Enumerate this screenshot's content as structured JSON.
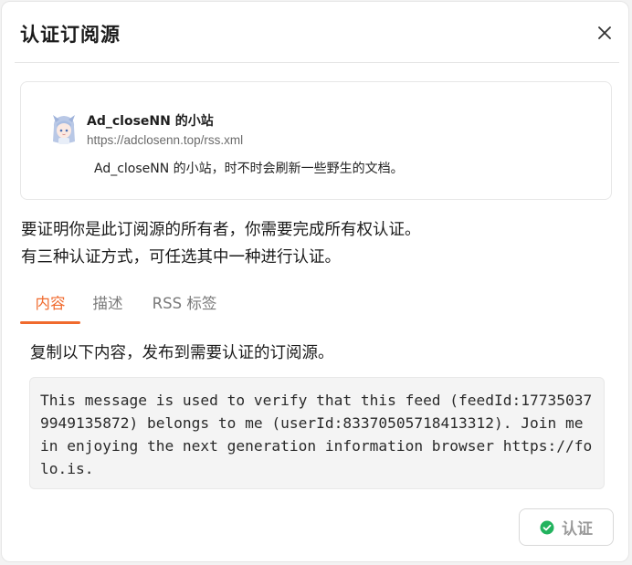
{
  "dialog": {
    "title": "认证订阅源",
    "close_icon": "close-icon"
  },
  "feed": {
    "name": "Ad_closeNN 的小站",
    "url": "https://adclosenn.top/rss.xml",
    "description": "Ad_closeNN 的小站，时不时会刷新一些野生的文档。",
    "avatar_icon": "anime-avatar-icon"
  },
  "intro": {
    "line1": "要证明你是此订阅源的所有者，你需要完成所有权认证。",
    "line2": "有三种认证方式，可任选其中一种进行认证。"
  },
  "tabs": [
    {
      "label": "内容",
      "active": true
    },
    {
      "label": "描述",
      "active": false
    },
    {
      "label": "RSS 标签",
      "active": false
    }
  ],
  "content_tab": {
    "instruction": "复制以下内容，发布到需要认证的订阅源。",
    "message": "This message is used to verify that this feed (feedId:177350379949135872) belongs to me (userId:83370505718413312). Join me in enjoying the next generation information browser https://folo.is."
  },
  "verify_button": {
    "label": "认证",
    "icon": "check-circle-icon",
    "icon_color": "#22b35e"
  },
  "colors": {
    "accent": "#f06a2d"
  }
}
